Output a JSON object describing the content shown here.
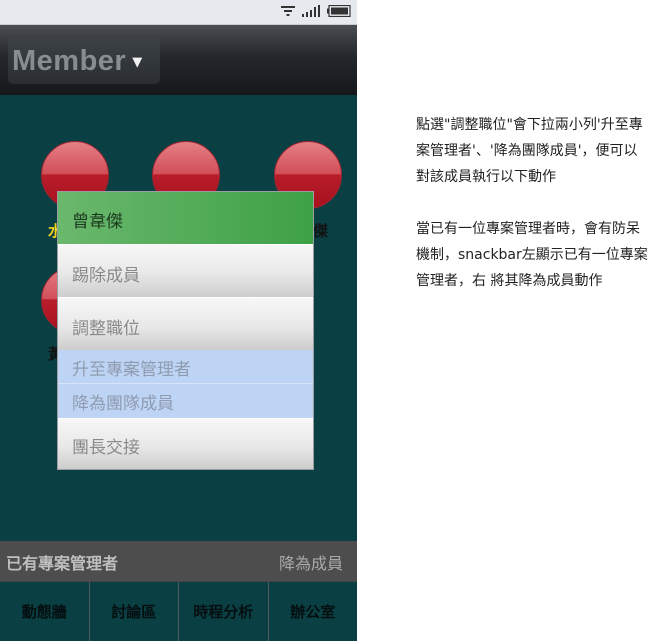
{
  "app": {
    "title": "Member",
    "title_caret": "▼"
  },
  "members": [
    {
      "name": ""
    },
    {
      "name": ""
    },
    {
      "name": "傑",
      "color": "#1a1a1a"
    },
    {
      "name": "",
      "color": "#1a1a1a"
    }
  ],
  "member_name_fragments": {
    "row1_left": "水",
    "row1_right": "傑",
    "row2_left": "黃"
  },
  "menu": {
    "header": "曾韋傑",
    "items": [
      {
        "label": "踢除成員"
      },
      {
        "label": "調整職位"
      }
    ],
    "subitems": [
      {
        "label": "升至專案管理者"
      },
      {
        "label": "降為團隊成員"
      }
    ],
    "last_item": {
      "label": "團長交接"
    }
  },
  "snackbar": {
    "message": "已有專案管理者",
    "action": "降為成員"
  },
  "tabs": [
    {
      "label": "動態牆"
    },
    {
      "label": "討論區"
    },
    {
      "label": "時程分析"
    },
    {
      "label": "辦公室"
    }
  ],
  "annotation": {
    "paragraph1": "點選\"調整職位\"會下拉兩小列'升至專案管理者'、'降為團隊成員'，便可以對該成員執行以下動作",
    "paragraph2": "當已有一位專案管理者時，會有防呆機制，snackbar左顯示已有一位專案管理者，右 將其降為成員動作"
  },
  "colors": {
    "background": "#0a3f44",
    "menu_header": "#3ea146",
    "submenu": "#bdd4f5",
    "snackbar": "#4d4d4d",
    "avatar": "#c8202e",
    "member_name_yellow": "#f2d21b"
  }
}
